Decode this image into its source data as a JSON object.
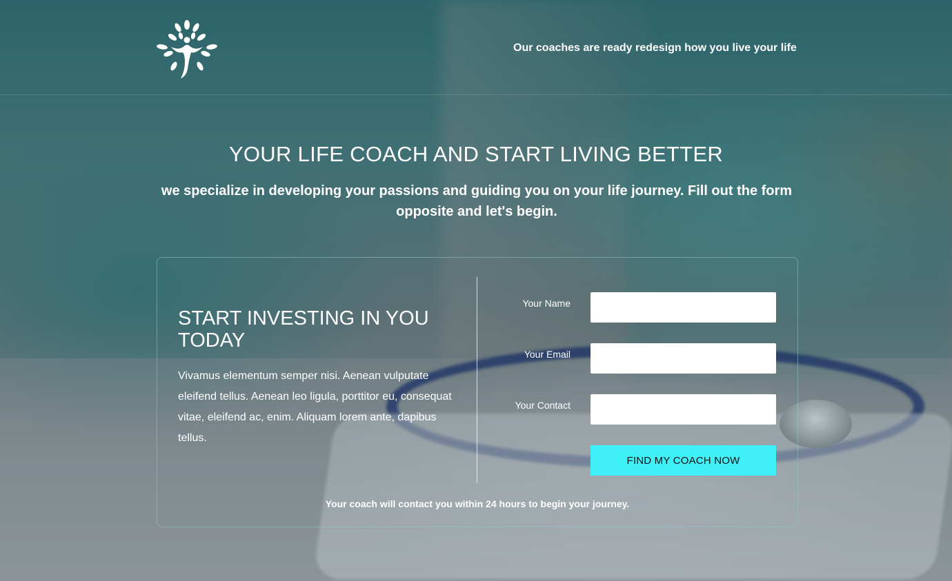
{
  "header": {
    "tagline": "Our coaches are ready redesign how you live your life",
    "logo_icon": "tree-person-icon"
  },
  "hero": {
    "title": "YOUR LIFE COACH AND START LIVING BETTER",
    "subtitle": "we specialize in developing your passions and guiding you on your life journey. Fill out the form opposite and let's begin."
  },
  "card": {
    "heading": "START INVESTING IN YOU TODAY",
    "text": "Vivamus elementum semper nisi. Aenean vulputate eleifend tellus. Aenean leo ligula, porttitor eu, consequat vitae, eleifend ac, enim. Aliquam lorem ante, dapibus tellus.",
    "form": {
      "name_label": "Your Name",
      "name_value": "",
      "email_label": "Your Email",
      "email_value": "",
      "contact_label": "Your Contact",
      "contact_value": "",
      "submit_label": "FIND MY COACH NOW"
    },
    "footer": "Your coach will contact you within 24 hours to begin your journey."
  },
  "colors": {
    "button": "#3ff0f7",
    "text": "#ffffff"
  }
}
